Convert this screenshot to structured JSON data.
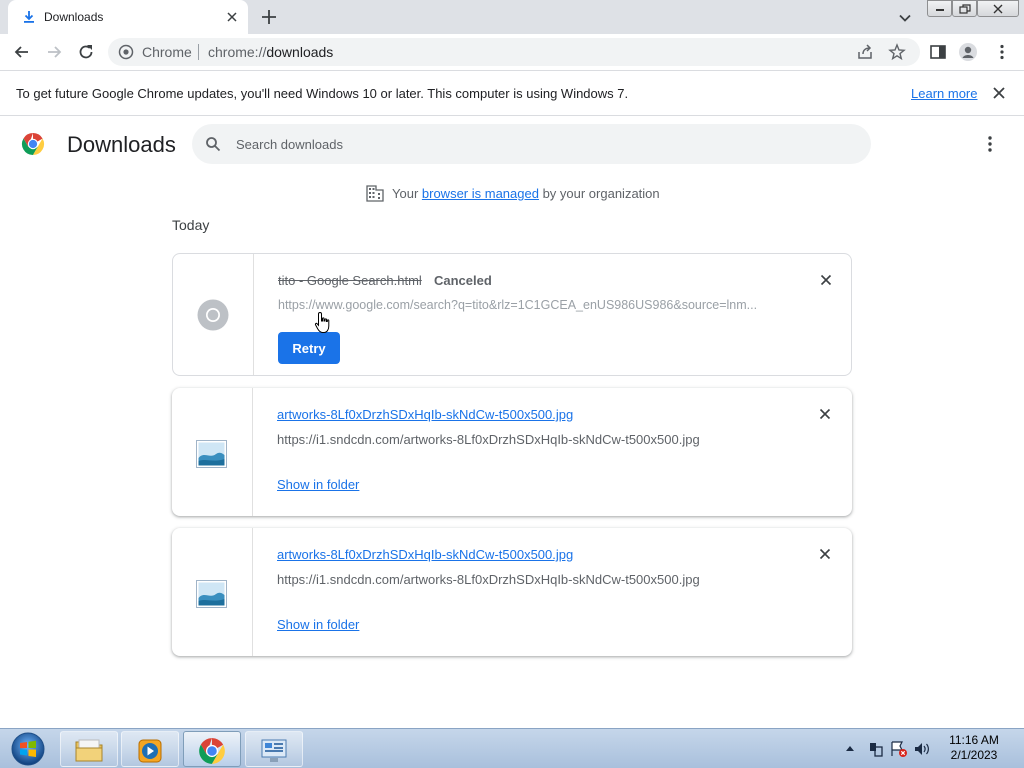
{
  "tab": {
    "title": "Downloads"
  },
  "omnibox": {
    "chip": "Chrome",
    "url_scheme": "chrome://",
    "url_host": "downloads"
  },
  "infobar": {
    "message": "To get future Google Chrome updates, you'll need Windows 10 or later. This computer is using Windows 7.",
    "learn_more": "Learn more"
  },
  "page": {
    "title": "Downloads",
    "search_placeholder": "Search downloads",
    "managed_prefix": "Your ",
    "managed_link": "browser is managed",
    "managed_suffix": " by your organization",
    "date_header": "Today"
  },
  "downloads": [
    {
      "filename": "tito - Google Search.html",
      "status": "Canceled",
      "url": "https://www.google.com/search?q=tito&rlz=1C1GCEA_enUS986US986&source=lnm...",
      "action": "Retry"
    },
    {
      "filename": "artworks-8Lf0xDrzhSDxHqIb-skNdCw-t500x500.jpg",
      "url": "https://i1.sndcdn.com/artworks-8Lf0xDrzhSDxHqIb-skNdCw-t500x500.jpg",
      "action": "Show in folder"
    },
    {
      "filename": "artworks-8Lf0xDrzhSDxHqIb-skNdCw-t500x500.jpg",
      "url": "https://i1.sndcdn.com/artworks-8Lf0xDrzhSDxHqIb-skNdCw-t500x500.jpg",
      "action": "Show in folder"
    }
  ],
  "taskbar": {
    "apps": [
      "windows-explorer",
      "media-player",
      "chrome",
      "control-panel"
    ],
    "time": "11:16 AM",
    "date": "2/1/2023"
  },
  "colors": {
    "accent": "#1a73e8",
    "tabstrip": "#dee1e6",
    "muted_text": "#5f6368"
  }
}
